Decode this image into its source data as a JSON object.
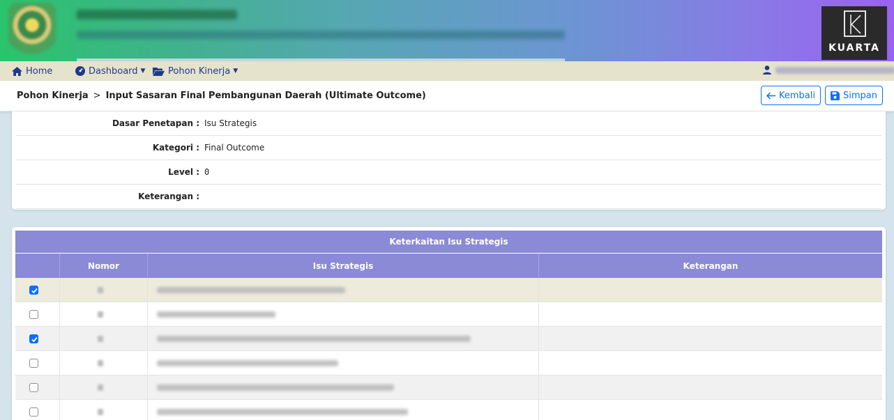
{
  "brand": {
    "kuarta_text": "KUARTA"
  },
  "nav": {
    "home": "Home",
    "dashboard": "Dashboard",
    "pohon_kinerja": "Pohon Kinerja"
  },
  "breadcrumb": {
    "parent": "Pohon Kinerja",
    "separator": ">",
    "current": "Input Sasaran Final Pembangunan Daerah (Ultimate Outcome)"
  },
  "actions": {
    "back_label": "Kembali",
    "save_label": "Simpan"
  },
  "info": {
    "rows": [
      {
        "label": "Dasar Penetapan :",
        "value": "Isu Strategis"
      },
      {
        "label": "Kategori :",
        "value": "Final Outcome"
      },
      {
        "label": "Level :",
        "value": "0"
      },
      {
        "label": "Keterangan :",
        "value": ""
      }
    ]
  },
  "table": {
    "title": "Keterkaitan Isu Strategis",
    "headers": [
      "",
      "Nomor",
      "Isu Strategis",
      "Keterangan"
    ],
    "rows": [
      {
        "checked": true
      },
      {
        "checked": false
      },
      {
        "checked": true
      },
      {
        "checked": false
      },
      {
        "checked": false
      },
      {
        "checked": false
      }
    ]
  },
  "colors": {
    "accent": "#0d6efd",
    "table_header": "#8a8ad6",
    "navbar_bg": "#e6e3cc",
    "page_bg": "#d4e3ec"
  }
}
